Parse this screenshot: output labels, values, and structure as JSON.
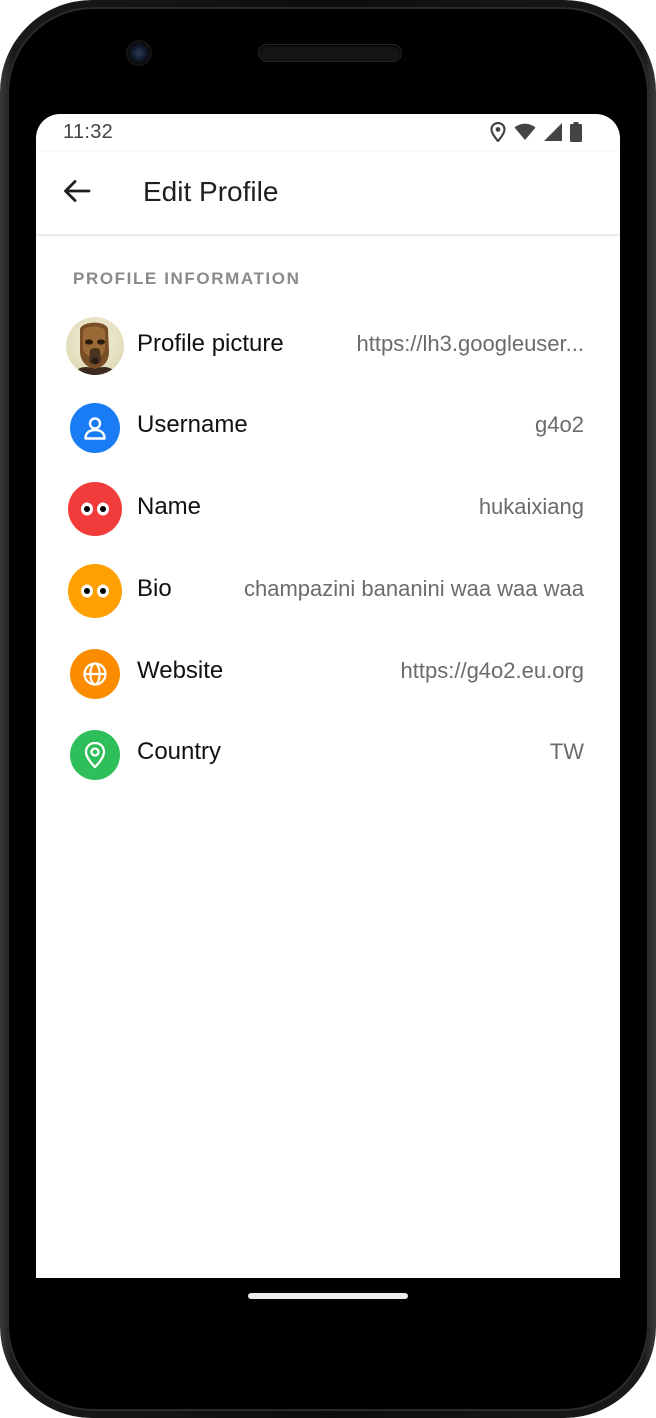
{
  "status_bar": {
    "time": "11:32",
    "icons": [
      "location-icon",
      "wifi-icon",
      "signal-icon",
      "battery-icon"
    ]
  },
  "app_bar": {
    "back_icon": "arrow-back-icon",
    "title": "Edit Profile"
  },
  "section": {
    "header": "PROFILE INFORMATION"
  },
  "rows": [
    {
      "label": "Profile picture",
      "value": "https://lh3.googleuser...",
      "icon": "avatar-image"
    },
    {
      "label": "Username",
      "value": "g4o2",
      "icon": "person-icon",
      "color": "#1a7cf5"
    },
    {
      "label": "Name",
      "value": "hukaixiang",
      "icon": "eyes-icon",
      "color": "#f23b3b"
    },
    {
      "label": "Bio",
      "value": "champazini bananini waa waa waa",
      "icon": "eyes-icon",
      "color": "#ffa000"
    },
    {
      "label": "Website",
      "value": "https://g4o2.eu.org",
      "icon": "globe-icon",
      "color": "#fb8c00"
    },
    {
      "label": "Country",
      "value": "TW",
      "icon": "location-pin-icon",
      "color": "#2ebf5a"
    }
  ],
  "colors": {
    "screen_bg": "#ffffff",
    "frame": "#0d0d0d"
  }
}
